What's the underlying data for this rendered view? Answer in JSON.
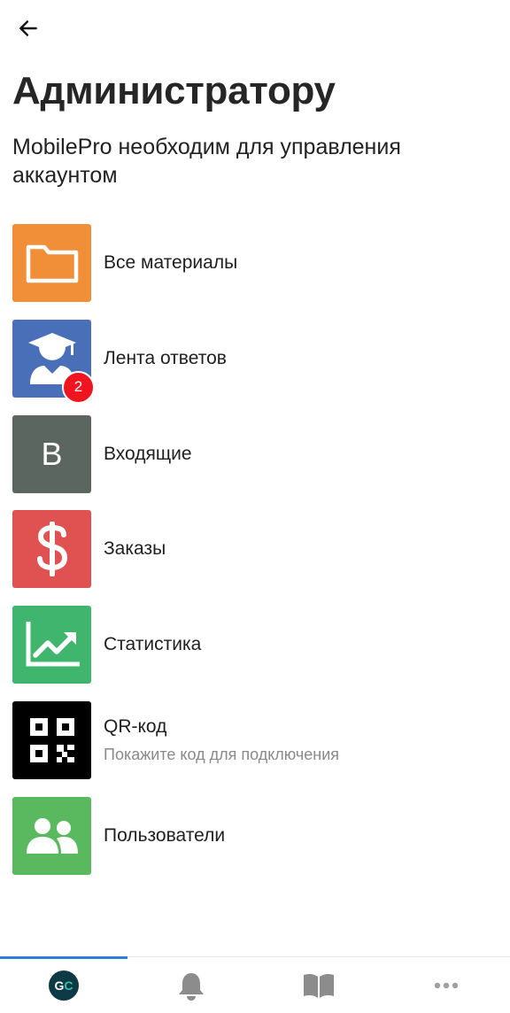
{
  "header": {
    "title": "Администратору",
    "subtitle": "MobilePro необходим для управления аккаунтом"
  },
  "menu": {
    "items": [
      {
        "label": "Все материалы",
        "icon": "folder-icon",
        "color": "#f18f38"
      },
      {
        "label": "Лента ответов",
        "icon": "graduate-icon",
        "color": "#4a6fb9",
        "badge": "2"
      },
      {
        "label": "Входящие",
        "icon": "letter-b-icon",
        "letter": "B",
        "color": "#5c6661"
      },
      {
        "label": "Заказы",
        "icon": "dollar-icon",
        "color": "#e05252"
      },
      {
        "label": "Статистика",
        "icon": "chart-trend-icon",
        "color": "#3fb56d"
      },
      {
        "label": "QR-код",
        "sublabel": "Покажите код для подключения",
        "icon": "qr-code-icon",
        "color": "#000000"
      },
      {
        "label": "Пользователи",
        "icon": "users-icon",
        "color": "#5ab95e"
      }
    ]
  },
  "bottom_nav": {
    "active": 0,
    "tabs": [
      {
        "icon": "gc-logo-icon",
        "logo_g": "G",
        "logo_c": "C"
      },
      {
        "icon": "bell-icon"
      },
      {
        "icon": "book-icon"
      },
      {
        "icon": "more-icon"
      }
    ],
    "accent": "#2b7fd4",
    "badge_color": "#f0141e"
  }
}
